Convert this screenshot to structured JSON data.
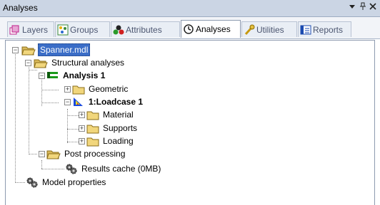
{
  "panel": {
    "title": "Analyses",
    "pin_glyph": "▾",
    "autohide_glyph": "ᵖ",
    "close_glyph": "×"
  },
  "tabs": [
    {
      "label": "Layers",
      "icon": "layers-icon",
      "active": false
    },
    {
      "label": "Groups",
      "icon": "groups-icon",
      "active": false
    },
    {
      "label": "Attributes",
      "icon": "attributes-icon",
      "active": false
    },
    {
      "label": "Analyses",
      "icon": "analyses-icon",
      "active": true
    },
    {
      "label": "Utilities",
      "icon": "utilities-icon",
      "active": false
    },
    {
      "label": "Reports",
      "icon": "reports-icon",
      "active": false
    }
  ],
  "tree": {
    "root": "Spanner.mdl",
    "structural": "Structural analyses",
    "analysis": "Analysis 1",
    "geometric": "Geometric",
    "loadcase": "1:Loadcase 1",
    "material": "Material",
    "supports": "Supports",
    "loading": "Loading",
    "post": "Post processing",
    "results": "Results cache (0MB)",
    "model_props": "Model properties"
  },
  "colors": {
    "selection": "#3a6dc7",
    "folder": "#f1d67c",
    "tab_border": "#8e9bb0"
  }
}
